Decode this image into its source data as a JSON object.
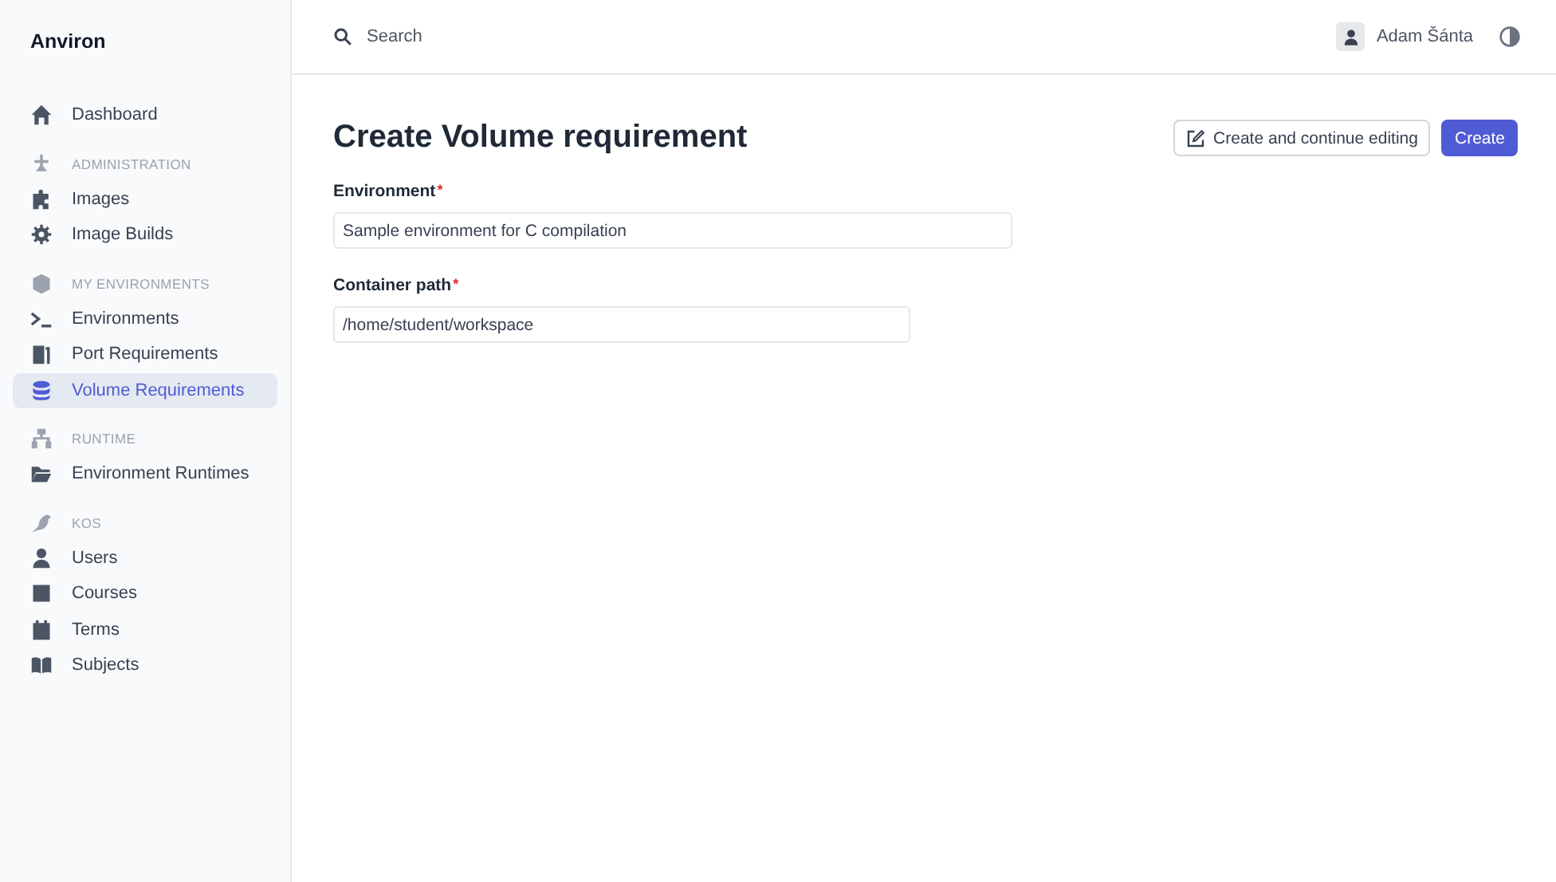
{
  "sidebar": {
    "brand": "Anviron",
    "top_items": [
      {
        "label": "Dashboard",
        "selected": false
      }
    ],
    "sections": [
      {
        "heading": "ADMINISTRATION",
        "items": [
          {
            "label": "Images",
            "selected": false
          },
          {
            "label": "Image Builds",
            "selected": false
          }
        ]
      },
      {
        "heading": "MY ENVIRONMENTS",
        "items": [
          {
            "label": "Environments",
            "selected": false
          },
          {
            "label": "Port Requirements",
            "selected": false
          },
          {
            "label": "Volume Requirements",
            "selected": true
          }
        ]
      },
      {
        "heading": "RUNTIME",
        "items": [
          {
            "label": "Environment Runtimes",
            "selected": false
          }
        ]
      },
      {
        "heading": "KOS",
        "items": [
          {
            "label": "Users",
            "selected": false
          },
          {
            "label": "Courses",
            "selected": false
          },
          {
            "label": "Terms",
            "selected": false
          },
          {
            "label": "Subjects",
            "selected": false
          }
        ]
      }
    ]
  },
  "topbar": {
    "search": {
      "placeholder": "Search"
    },
    "user": "Adam Šánta"
  },
  "page": {
    "title": "Create Volume requirement",
    "buttons": [
      {
        "label": "Create and continue editing",
        "kind": "secondary"
      },
      {
        "label": "Create",
        "kind": "primary"
      }
    ],
    "fields": [
      {
        "label": "Environment",
        "required": true,
        "mark": "*",
        "value": "Sample environment for C compilation"
      },
      {
        "label": "Container path",
        "required": true,
        "mark": "*",
        "value": "/home/student/workspace"
      }
    ]
  }
}
